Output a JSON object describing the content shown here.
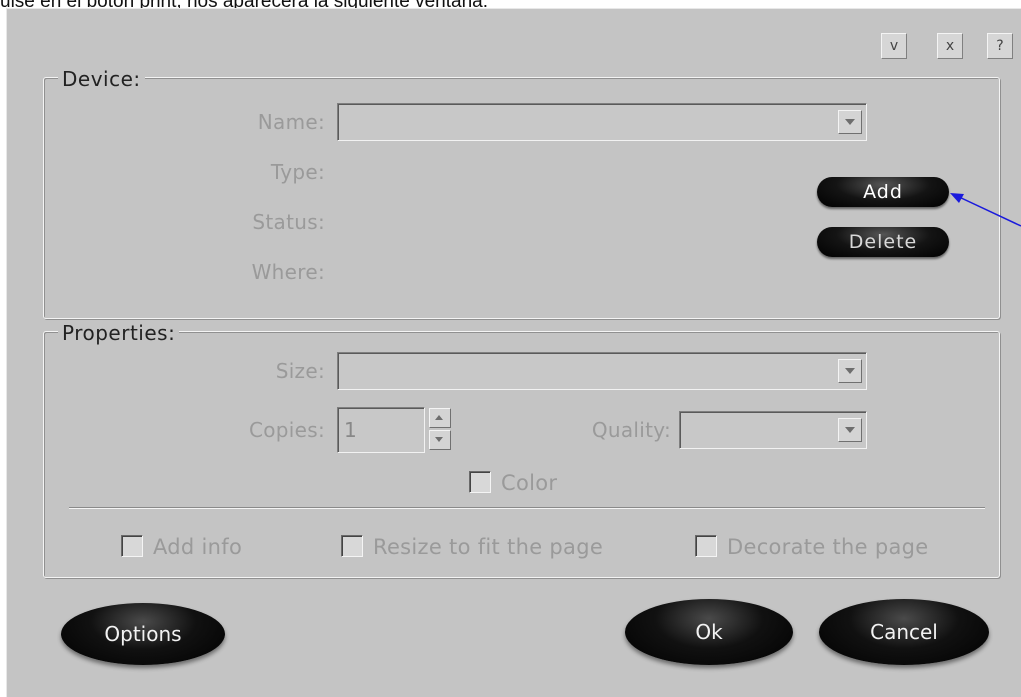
{
  "caption": "ulse en el botón print, nos aparecerá la siguiente ventana:",
  "title_buttons": [
    "v",
    "x",
    "?"
  ],
  "device": {
    "legend": "Device:",
    "name_label": "Name:",
    "type_label": "Type:",
    "status_label": "Status:",
    "where_label": "Where:",
    "name_value": "",
    "add_label": "Add",
    "delete_label": "Delete"
  },
  "properties": {
    "legend": "Properties:",
    "size_label": "Size:",
    "copies_label": "Copies:",
    "copies_value": "1",
    "quality_label": "Quality:",
    "color_label": "Color",
    "add_info_label": "Add info",
    "resize_label": "Resize to fit the page",
    "decorate_label": "Decorate the page"
  },
  "footer": {
    "options_label": "Options",
    "ok_label": "Ok",
    "cancel_label": "Cancel"
  },
  "colors": {
    "dialog_bg": "#c4c4c4",
    "arrow": "#1a1adc",
    "disabled_text": "#9a9a9a"
  }
}
